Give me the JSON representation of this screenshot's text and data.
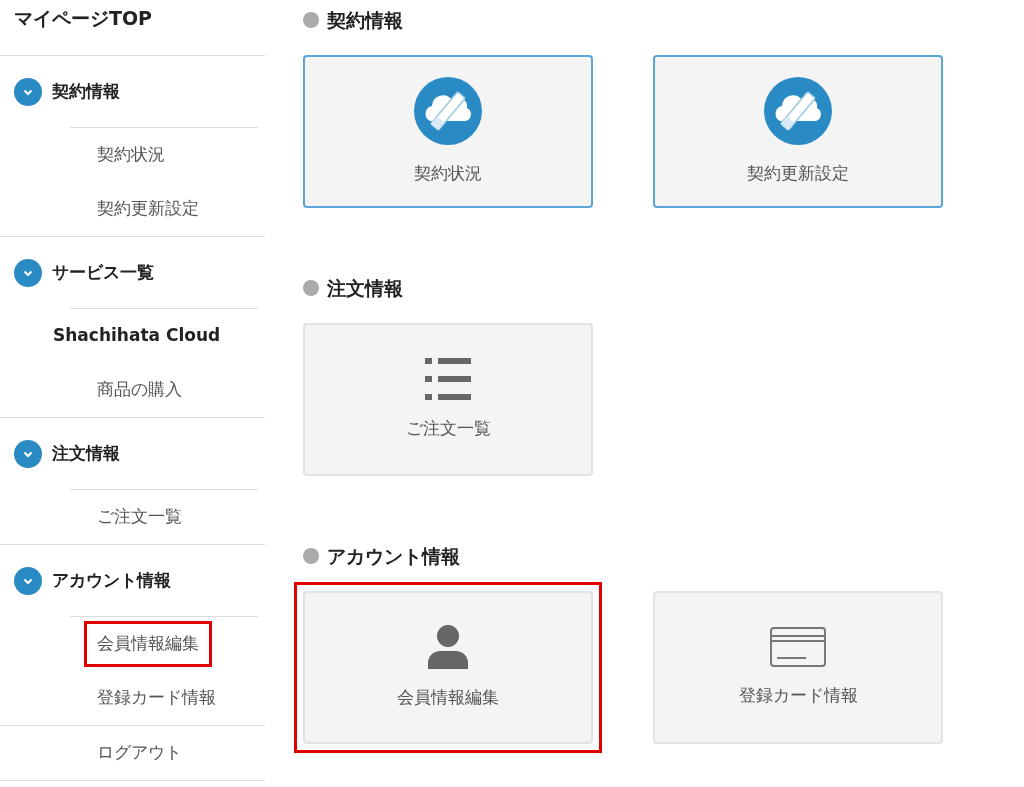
{
  "sidebar": {
    "top_link": "マイページTOP",
    "groups": [
      {
        "title": "契約情報",
        "expanded": true,
        "items": [
          {
            "label": "契約状況",
            "kind": "link",
            "highlighted": false
          },
          {
            "label": "契約更新設定",
            "kind": "link",
            "highlighted": false
          }
        ]
      },
      {
        "title": "サービス一覧",
        "expanded": true,
        "items": [
          {
            "label": "Shachihata Cloud",
            "kind": "bold",
            "highlighted": false
          },
          {
            "label": "商品の購入",
            "kind": "link",
            "highlighted": false
          }
        ]
      },
      {
        "title": "注文情報",
        "expanded": true,
        "items": [
          {
            "label": "ご注文一覧",
            "kind": "link",
            "highlighted": false
          }
        ]
      },
      {
        "title": "アカウント情報",
        "expanded": true,
        "items": [
          {
            "label": "会員情報編集",
            "kind": "link",
            "highlighted": true
          },
          {
            "label": "登録カード情報",
            "kind": "link",
            "highlighted": false
          }
        ]
      }
    ],
    "footer_items": [
      {
        "label": "ログアウト"
      }
    ]
  },
  "sections": [
    {
      "title": "契約情報",
      "cards": [
        {
          "label": "契約状況",
          "kind": "cloud",
          "outlined": true,
          "highlighted": false
        },
        {
          "label": "契約更新設定",
          "kind": "cloud",
          "outlined": true,
          "highlighted": false
        }
      ]
    },
    {
      "title": "注文情報",
      "cards": [
        {
          "label": "ご注文一覧",
          "kind": "list",
          "outlined": false,
          "highlighted": false
        }
      ]
    },
    {
      "title": "アカウント情報",
      "cards": [
        {
          "label": "会員情報編集",
          "kind": "person",
          "outlined": false,
          "highlighted": true
        },
        {
          "label": "登録カード情報",
          "kind": "card",
          "outlined": false,
          "highlighted": false
        }
      ]
    }
  ]
}
